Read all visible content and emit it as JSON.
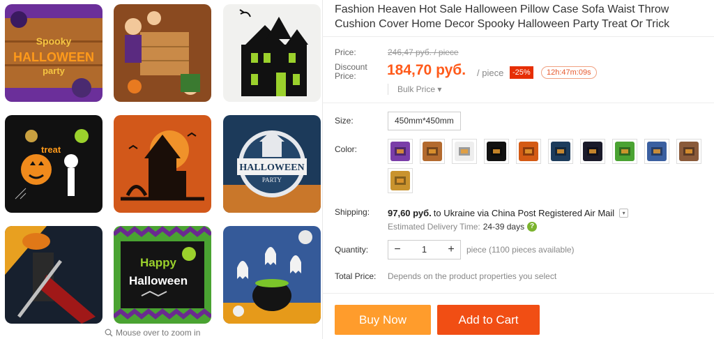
{
  "product": {
    "title": "Fashion Heaven Hot Sale Halloween Pillow Case Sofa Waist Throw Cushion Cover Home Decor Spooky Halloween Party Treat Or Trick"
  },
  "gallery": {
    "zoom_hint": "Mouse over to zoom in",
    "thumbnails": [
      {
        "art": "pillow-spooky-halloween-party-icon",
        "bg": "#7a3da8",
        "text1": "Spooky",
        "text2": "HALLOWEEN",
        "text3": "party"
      },
      {
        "art": "pillow-haunted-house-icon",
        "bg": "#f2f2f2"
      },
      {
        "art": "pillow-witch-kids-wood-icon",
        "bg": "#b36a2e"
      },
      {
        "art": "pillow-halloween-treat-icon",
        "bg": "#111111",
        "text1": "treat"
      },
      {
        "art": "pillow-orange-castle-icon",
        "bg": "#d45a14"
      },
      {
        "art": "pillow-halloween-party-banner-icon",
        "bg": "#1d3c5c",
        "text1": "HALLOWEEN",
        "text2": "PARTY"
      },
      {
        "art": "pillow-pumpkin-knight-icon",
        "bg": "#1a1a2a"
      },
      {
        "art": "pillow-happy-halloween-zigzag-icon",
        "bg": "#4aa332",
        "text1": "Happy",
        "text2": "Halloween"
      },
      {
        "art": "pillow-ghosts-cauldron-icon",
        "bg": "#3a5fa0"
      }
    ]
  },
  "price": {
    "label": "Price:",
    "old": "246,47 руб. / piece",
    "discount_label_1": "Discount",
    "discount_label_2": "Price:",
    "current": "184,70 руб.",
    "per": "/ piece",
    "badge": "-25%",
    "countdown": "12h:47m:09s",
    "bulk": "Bulk Price ▾",
    "accent_color": "#ff5a1a"
  },
  "size": {
    "label": "Size:",
    "option": "450mm*450mm"
  },
  "color": {
    "label": "Color:",
    "swatches": [
      {
        "name": "color-swatch-spooky-party",
        "bg": "#7a3da8"
      },
      {
        "name": "color-swatch-wood-kids",
        "bg": "#b36a2e"
      },
      {
        "name": "color-swatch-haunted-house",
        "bg": "#eeeeee"
      },
      {
        "name": "color-swatch-treat-black",
        "bg": "#111111"
      },
      {
        "name": "color-swatch-orange-castle",
        "bg": "#d45a14"
      },
      {
        "name": "color-swatch-party-banner",
        "bg": "#1d3c5c"
      },
      {
        "name": "color-swatch-pumpkin-knight",
        "bg": "#1a1a2a"
      },
      {
        "name": "color-swatch-happy-zigzag",
        "bg": "#4aa332"
      },
      {
        "name": "color-swatch-ghosts",
        "bg": "#3a5fa0"
      },
      {
        "name": "color-swatch-brown-pillow",
        "bg": "#8a5a3a"
      },
      {
        "name": "color-swatch-gold-pillow",
        "bg": "#c9932e"
      }
    ]
  },
  "shipping": {
    "label": "Shipping:",
    "amount": "97,60 руб.",
    "route": "to Ukraine via China Post Registered Air Mail",
    "eta_label": "Estimated Delivery Time:",
    "eta_days": "24-39 days",
    "help": "?"
  },
  "quantity": {
    "label": "Quantity:",
    "minus": "−",
    "value": "1",
    "plus": "+",
    "note": "piece (1100 pieces available)"
  },
  "total": {
    "label": "Total Price:",
    "note": "Depends on the product properties you select"
  },
  "buttons": {
    "buy": "Buy Now",
    "cart": "Add to Cart"
  }
}
